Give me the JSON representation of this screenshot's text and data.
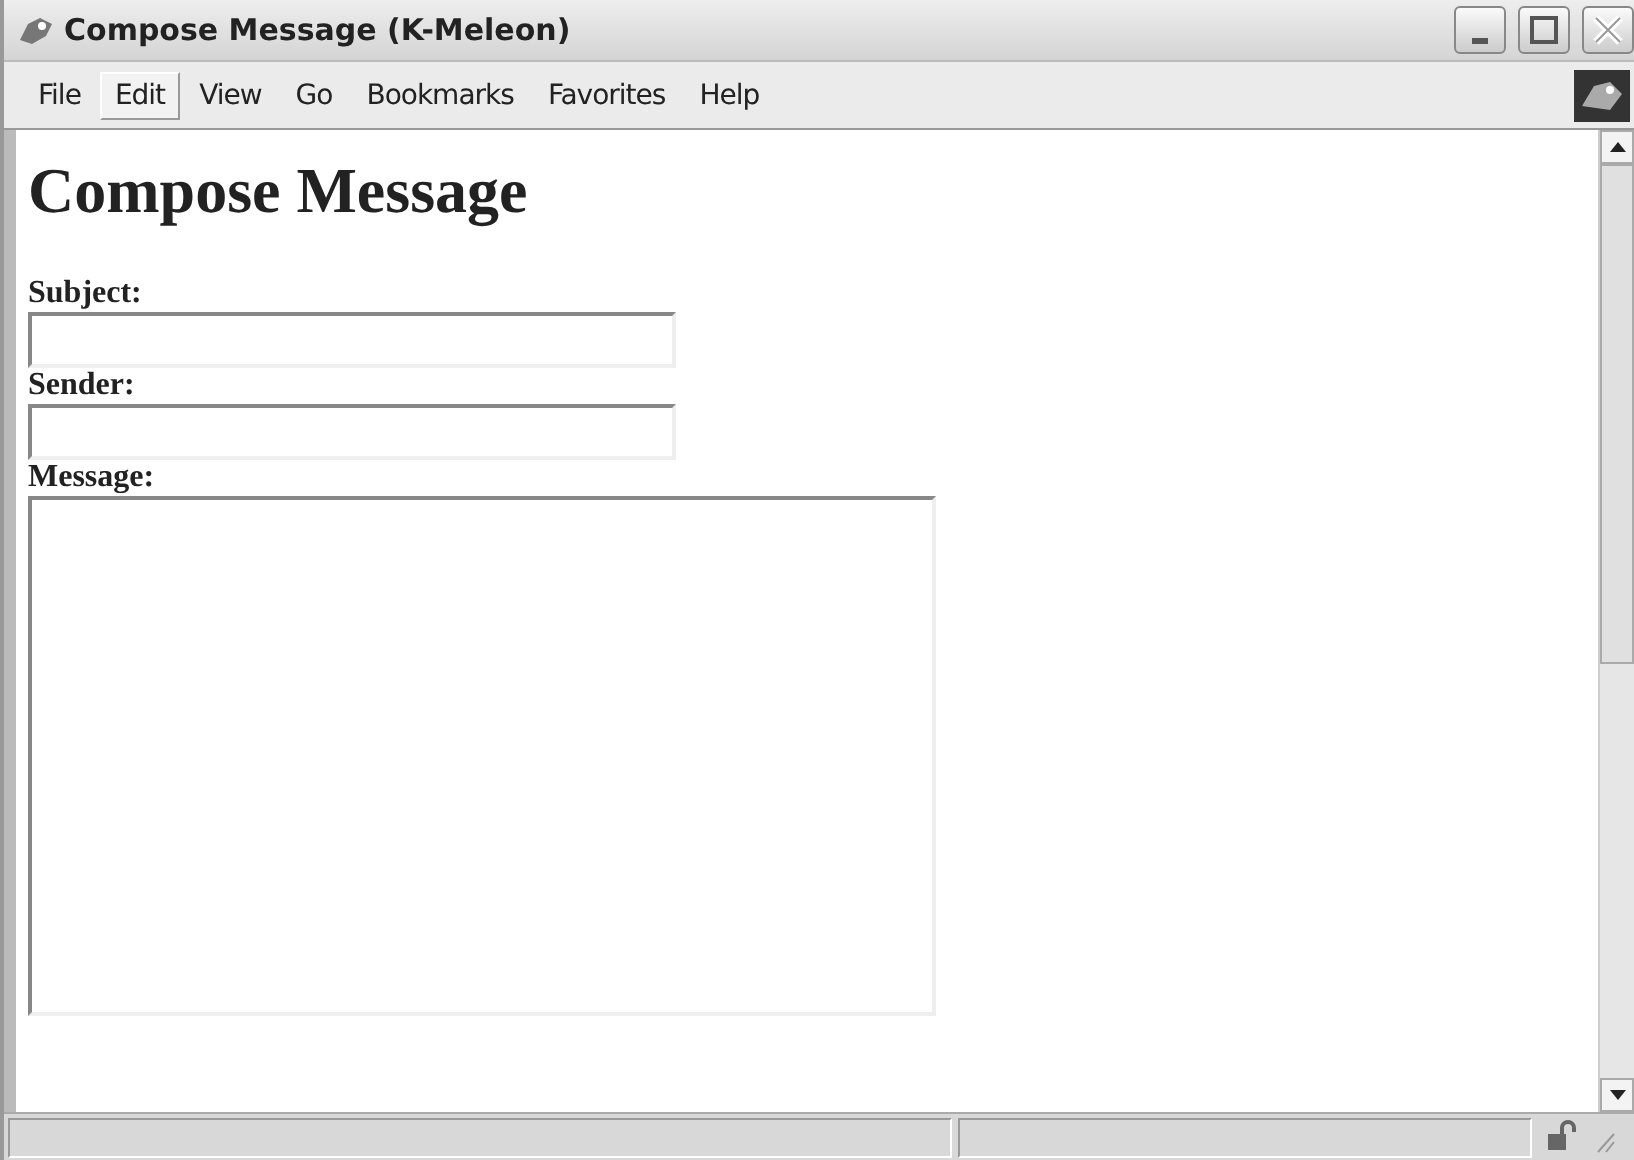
{
  "window": {
    "title": "Compose Message (K-Meleon)"
  },
  "menu": [
    {
      "label": "File",
      "selected": false
    },
    {
      "label": "Edit",
      "selected": true
    },
    {
      "label": "View",
      "selected": false
    },
    {
      "label": "Go",
      "selected": false
    },
    {
      "label": "Bookmarks",
      "selected": false
    },
    {
      "label": "Favorites",
      "selected": false
    },
    {
      "label": "Help",
      "selected": false
    }
  ],
  "page": {
    "heading": "Compose Message",
    "fields": [
      {
        "label": "Subject:",
        "kind": "line"
      },
      {
        "label": "Sender:",
        "kind": "line"
      },
      {
        "label": "Message:",
        "kind": "area"
      }
    ]
  }
}
